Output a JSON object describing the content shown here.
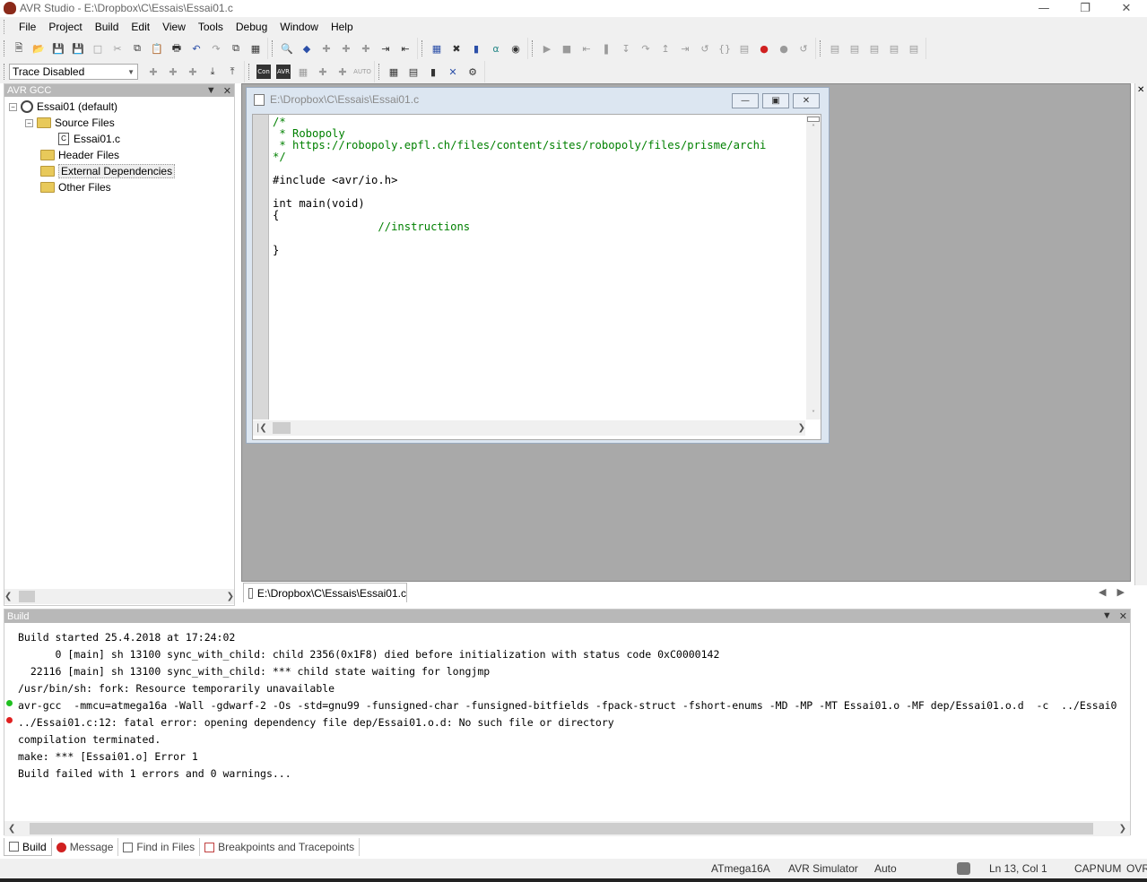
{
  "window": {
    "title": "AVR Studio - E:\\Dropbox\\C\\Essais\\Essai01.c"
  },
  "menu": [
    "File",
    "Project",
    "Build",
    "Edit",
    "View",
    "Tools",
    "Debug",
    "Window",
    "Help"
  ],
  "toolbar2": {
    "trace_select": "Trace Disabled"
  },
  "project_panel": {
    "title": "AVR GCC",
    "root": "Essai01 (default)",
    "source_files": "Source Files",
    "file": "Essai01.c",
    "header_files": "Header Files",
    "external_deps": "External Dependencies",
    "other_files": "Other Files"
  },
  "editor": {
    "title": "E:\\Dropbox\\C\\Essais\\Essai01.c",
    "tab_label": "E:\\Dropbox\\C\\Essais\\Essai01.c",
    "lines": [
      {
        "text": "/*",
        "comment": true
      },
      {
        "text": " * Robopoly",
        "comment": true
      },
      {
        "text": " * https://robopoly.epfl.ch/files/content/sites/robopoly/files/prisme/archi",
        "comment": true
      },
      {
        "text": "*/",
        "comment": true
      },
      {
        "text": "",
        "comment": false
      },
      {
        "text": "#include <avr/io.h>",
        "comment": false
      },
      {
        "text": "",
        "comment": false
      },
      {
        "text": "int main(void)",
        "comment": false
      },
      {
        "text": "{",
        "comment": false
      },
      {
        "text": "                //instructions",
        "comment": true
      },
      {
        "text": "",
        "comment": false
      },
      {
        "text": "}",
        "comment": false
      }
    ]
  },
  "build_panel": {
    "title": "Build",
    "lines": [
      "Build started 25.4.2018 at 17:24:02",
      "      0 [main] sh 13100 sync_with_child: child 2356(0x1F8) died before initialization with status code 0xC0000142",
      "  22116 [main] sh 13100 sync_with_child: *** child state waiting for longjmp",
      "/usr/bin/sh: fork: Resource temporarily unavailable",
      "avr-gcc  -mmcu=atmega16a -Wall -gdwarf-2 -Os -std=gnu99 -funsigned-char -funsigned-bitfields -fpack-struct -fshort-enums -MD -MP -MT Essai01.o -MF dep/Essai01.o.d  -c  ../Essai0",
      "../Essai01.c:12: fatal error: opening dependency file dep/Essai01.o.d: No such file or directory",
      "compilation terminated.",
      "make: *** [Essai01.o] Error 1",
      "Build failed with 1 errors and 0 warnings..."
    ],
    "tabs": [
      "Build",
      "Message",
      "Find in Files",
      "Breakpoints and Tracepoints"
    ]
  },
  "status": {
    "device": "ATmega16A",
    "simulator": "AVR Simulator",
    "mode": "Auto",
    "position": "Ln 13, Col 1",
    "cap": "CAP",
    "num": "NUM",
    "ovr": "OVR"
  },
  "colors": {
    "comment": "#008000",
    "error_dot": "#e02020",
    "ok_dot": "#20c020"
  }
}
